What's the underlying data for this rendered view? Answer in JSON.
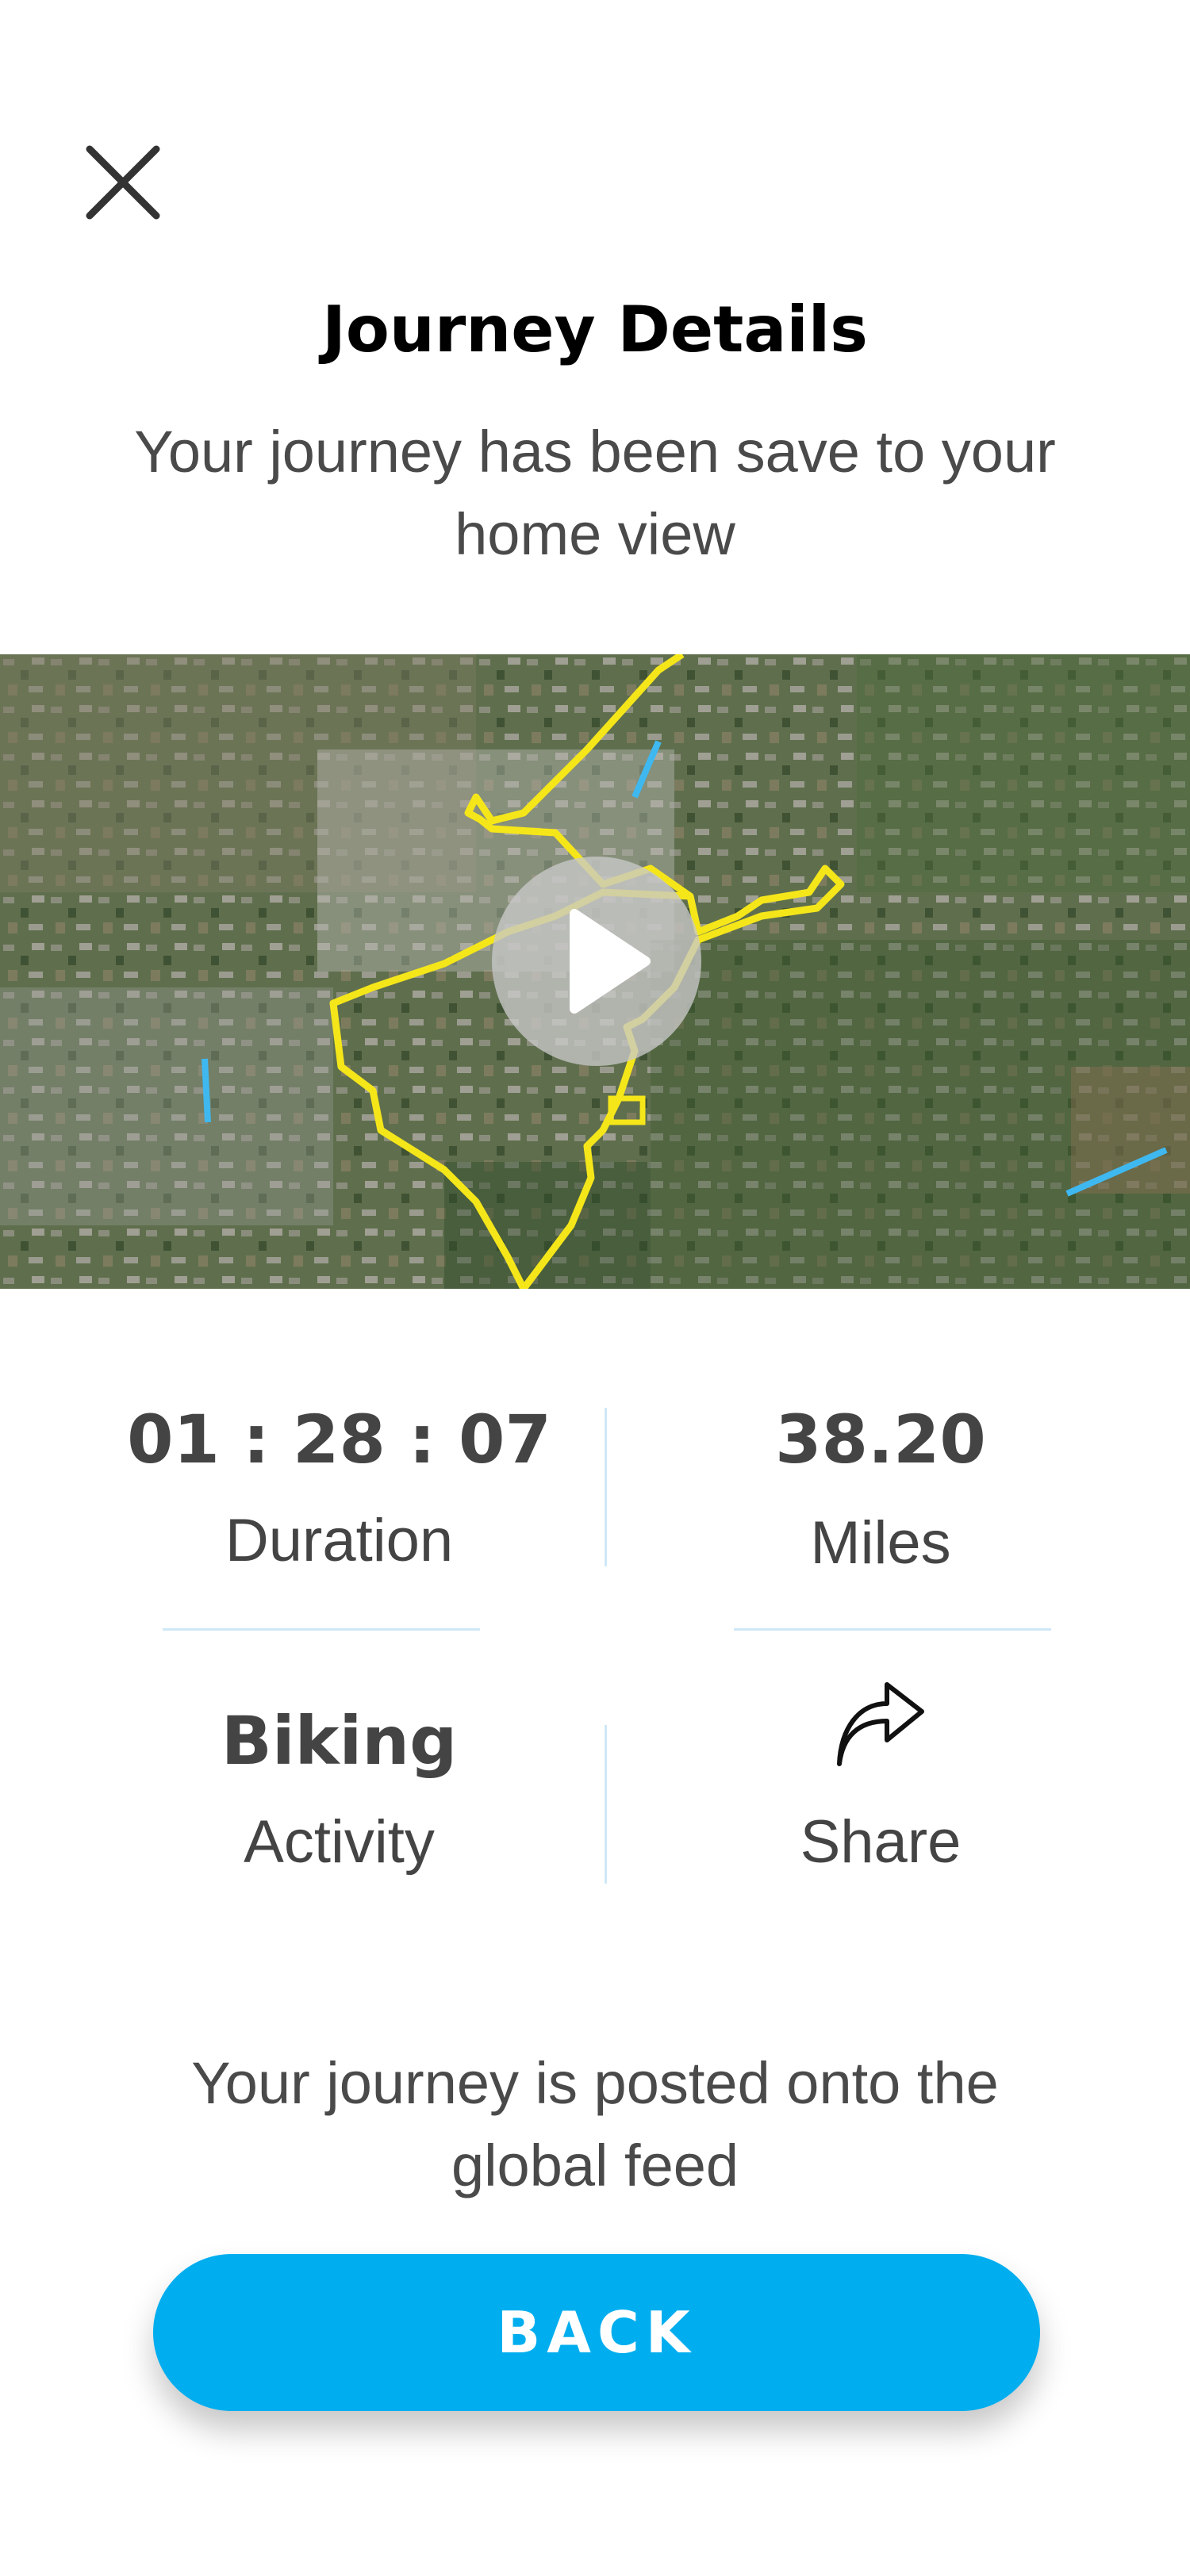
{
  "header": {
    "title": "Journey Details",
    "subtitle": "Your journey has been save to your home view"
  },
  "icons": {
    "close": "close-icon",
    "play": "play-icon",
    "share": "share-icon"
  },
  "stats": {
    "duration": {
      "value": "01 : 28 : 07",
      "label": "Duration"
    },
    "distance": {
      "value": "38.20",
      "label": "Miles"
    },
    "activity": {
      "value": "Biking",
      "label": "Activity"
    },
    "share": {
      "label": "Share"
    }
  },
  "footer": {
    "note": "Your journey is posted onto the global feed",
    "back_label": "BACK"
  },
  "colors": {
    "accent": "#00aeef",
    "divider": "#cfe8f7",
    "route": "#f5e61a",
    "text": "#444444"
  }
}
